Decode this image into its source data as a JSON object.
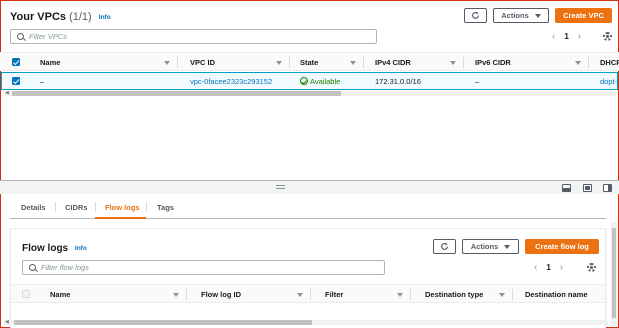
{
  "vpcs": {
    "title": "Your VPCs",
    "count": "(1/1)",
    "info_label": "Info",
    "refresh_icon": "refresh-icon",
    "actions_label": "Actions",
    "create_label": "Create VPC",
    "search_placeholder": "Filter VPCs",
    "page": "1",
    "columns": [
      "Name",
      "VPC ID",
      "State",
      "IPv4 CIDR",
      "IPv6 CIDR",
      "DHCP"
    ],
    "rows": [
      {
        "name": "–",
        "vpc_id": "vpc-0facee2323c293152",
        "state": "Available",
        "ipv4_cidr": "172.31.0.0/16",
        "ipv6_cidr": "–",
        "dhcp": "dopt-"
      }
    ]
  },
  "tabs": [
    {
      "label": "Details"
    },
    {
      "label": "CIDRs"
    },
    {
      "label": "Flow logs",
      "active": true
    },
    {
      "label": "Tags"
    }
  ],
  "flow_logs": {
    "title": "Flow logs",
    "info_label": "Info",
    "actions_label": "Actions",
    "create_label": "Create flow log",
    "search_placeholder": "Filter flow logs",
    "page": "1",
    "columns": [
      "Name",
      "Flow log ID",
      "Filter",
      "Destination type",
      "Destination name"
    ]
  },
  "colors": {
    "primary": "#ec7211",
    "link": "#0073bb",
    "success": "#1d8102",
    "selected_row_border": "#00a1c9",
    "frame_border": "#d13212"
  }
}
